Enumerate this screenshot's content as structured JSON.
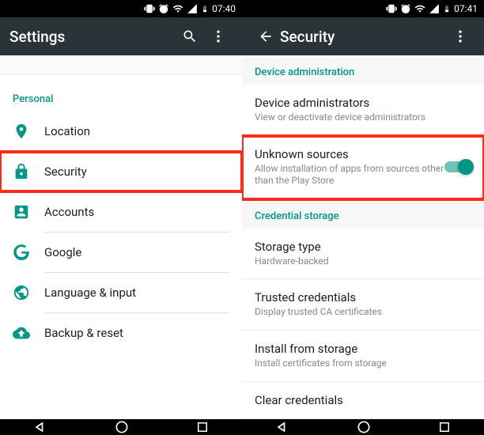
{
  "colors": {
    "accent": "#009688",
    "highlight": "#ff2a1a",
    "appbar": "#2a3438"
  },
  "left": {
    "status_time": "07:40",
    "appbar_title": "Settings",
    "section_personal": "Personal",
    "items": {
      "location": "Location",
      "security": "Security",
      "accounts": "Accounts",
      "google": "Google",
      "language": "Language & input",
      "backup": "Backup & reset"
    }
  },
  "right": {
    "status_time": "07:41",
    "appbar_title": "Security",
    "section_device_admin": "Device administration",
    "device_admins_title": "Device administrators",
    "device_admins_sub": "View or deactivate device administrators",
    "unknown_title": "Unknown sources",
    "unknown_sub": "Allow installation of apps from sources other than the Play Store",
    "unknown_toggle_on": true,
    "section_cred": "Credential storage",
    "storage_type_title": "Storage type",
    "storage_type_sub": "Hardware-backed",
    "trusted_title": "Trusted credentials",
    "trusted_sub": "Display trusted CA certificates",
    "install_title": "Install from storage",
    "install_sub": "Install certificates from storage",
    "clear_title": "Clear credentials"
  }
}
